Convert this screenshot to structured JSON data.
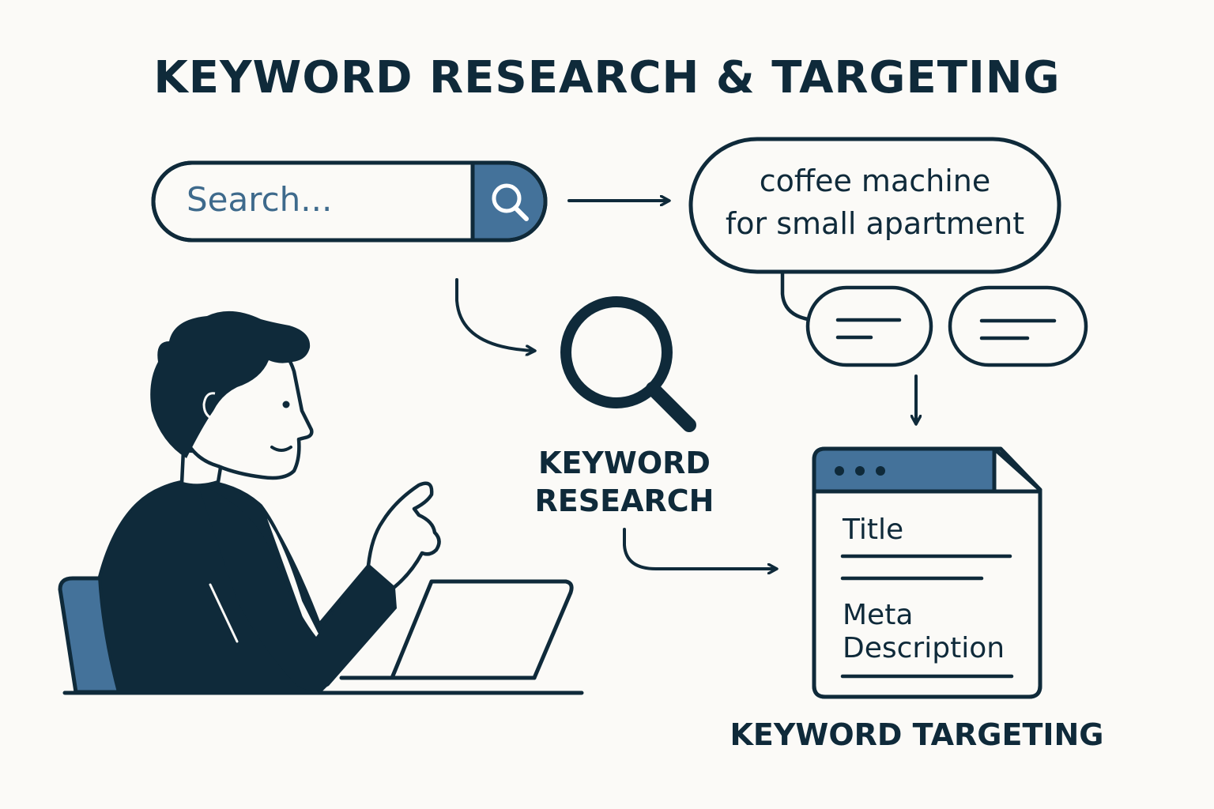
{
  "title": "KEYWORD RESEARCH & TARGETING",
  "search": {
    "placeholder": "Search...",
    "button_icon": "search-icon"
  },
  "query_bubble": {
    "line1": "coffee machine",
    "line2": "for small apartment"
  },
  "keyword_research": {
    "line1": "KEYWORD",
    "line2": "RESEARCH",
    "icon": "magnifier-icon"
  },
  "document": {
    "title_label": "Title",
    "meta_line1": "Meta",
    "meta_line2": "Description"
  },
  "keyword_targeting": {
    "label": "KEYWORD TARGETING"
  },
  "colors": {
    "dark": "#0f2a3a",
    "accent": "#44729a",
    "background": "#fbfaf7"
  }
}
